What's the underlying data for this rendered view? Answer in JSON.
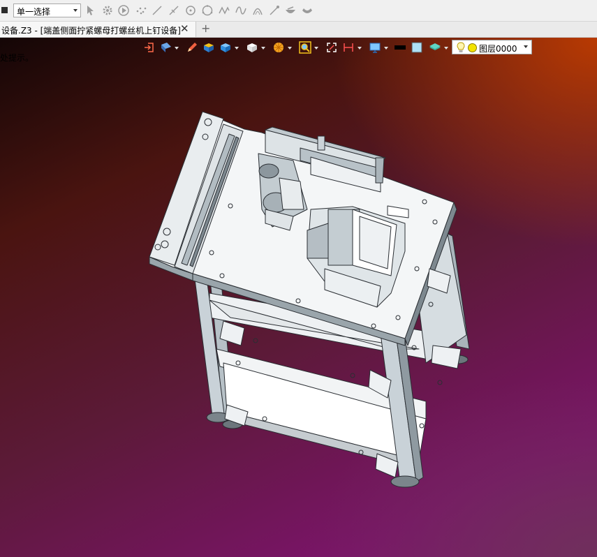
{
  "selection_toolbar": {
    "filter_value": "单一选择",
    "tools": [
      "pointer-icon",
      "gear-filter-icon",
      "play-icon",
      "points-icon",
      "line-icon",
      "cross-line-icon",
      "circle-center-icon",
      "circle-icon",
      "spline-icon",
      "curve-icon",
      "arc-icon",
      "pick-icon",
      "bowl-icon",
      "surface-icon"
    ]
  },
  "document_tab": {
    "title": "设备.Z3 - [端盖侧面拧紧螺母打螺丝机上钉设备]",
    "close_label": "✕",
    "add_label": "+"
  },
  "viewport": {
    "hint_text": "处提示。",
    "layer": {
      "name": "图层0000"
    }
  },
  "colors": {
    "accent": "#f2e200",
    "background_top_right": "#be3c00",
    "background_bottom_left": "#7e1a6e"
  }
}
